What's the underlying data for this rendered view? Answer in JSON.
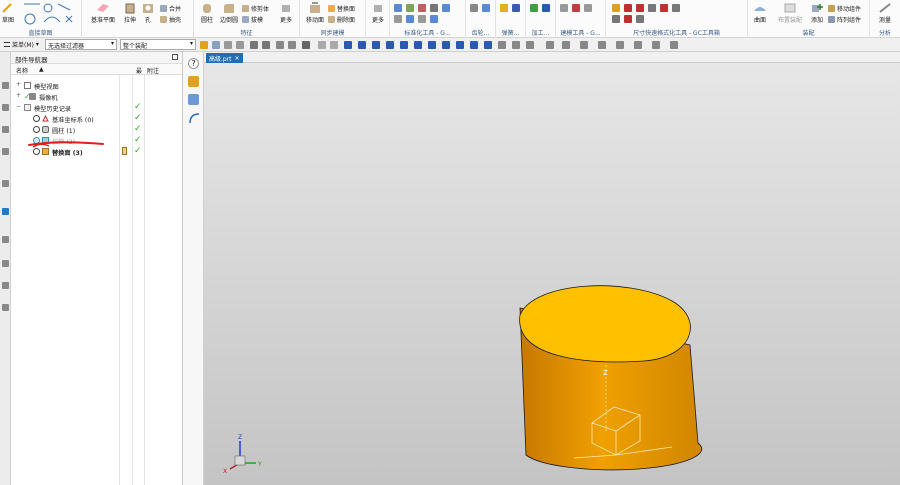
{
  "ribbon": {
    "groups": [
      {
        "label": "直接草图",
        "buttons": [
          "草图"
        ]
      },
      {
        "label": "",
        "buttons": [
          "基准平面",
          "拉伸",
          "孔",
          "合并",
          "抽壳"
        ]
      },
      {
        "label": "特征",
        "buttons": [
          "圆柱",
          "边倒圆",
          "修剪体",
          "拔模",
          "更多"
        ]
      },
      {
        "label": "同步建模",
        "buttons": [
          "移动面",
          "替换面",
          "删除面"
        ]
      },
      {
        "label": "",
        "buttons": [
          "更多"
        ]
      },
      {
        "label": "标准化工具 - G...",
        "buttons": []
      },
      {
        "label": "齿轮...",
        "buttons": []
      },
      {
        "label": "弹簧...",
        "buttons": []
      },
      {
        "label": "加工...",
        "buttons": []
      },
      {
        "label": "建模工具 - G...",
        "buttons": []
      },
      {
        "label": "尺寸快速格式化工具 - GC工具箱",
        "buttons": []
      },
      {
        "label": "装配",
        "buttons": [
          "曲面",
          "布置装配",
          "添加",
          "移动组件",
          "阵列组件"
        ]
      },
      {
        "label": "分析",
        "buttons": [
          "测量"
        ]
      }
    ]
  },
  "toolbar2": {
    "menu_label": "菜单(M)",
    "filter_select": "无选择过滤器",
    "scope_select": "整个装配"
  },
  "navigator": {
    "title": "部件导航器",
    "columns": [
      "名称",
      "▲",
      "",
      "最",
      "附注"
    ],
    "rows": [
      {
        "name": "模型视图",
        "level": 0,
        "check": false
      },
      {
        "name": "摄像机",
        "level": 0,
        "check": false
      },
      {
        "name": "模型历史记录",
        "level": 0,
        "check": true
      },
      {
        "name": "基准坐标系 (0)",
        "level": 1,
        "check": true
      },
      {
        "name": "圆柱 (1)",
        "level": 1,
        "check": true
      },
      {
        "name": "拉伸 (2)",
        "level": 1,
        "check": true
      },
      {
        "name": "替换面 (3)",
        "level": 1,
        "check": true
      }
    ]
  },
  "tab": {
    "label": "高级.prt",
    "close": "×"
  },
  "colors": {
    "accent": "#1f6fb8",
    "part_top": "#ffc000",
    "part_side": "#f0a000",
    "check": "#2eaa22",
    "annotation": "#e21b1b"
  }
}
